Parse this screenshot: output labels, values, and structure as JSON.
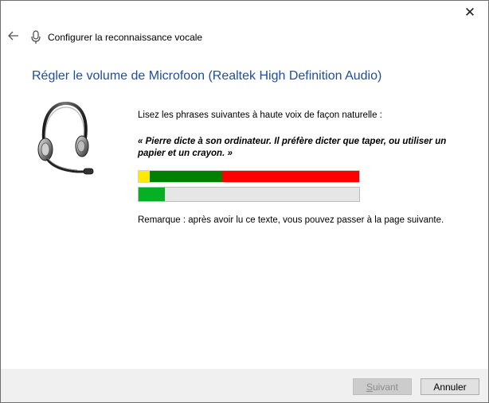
{
  "window": {
    "close_label": "✕"
  },
  "header": {
    "title": "Configurer la reconnaissance vocale"
  },
  "main": {
    "heading": "Régler le volume de Microfoon (Realtek High Definition Audio)",
    "instruction": "Lisez les phrases suivantes à haute voix de façon naturelle :",
    "sample_text": "« Pierre dicte à son ordinateur. Il préfère dicter que taper, ou utiliser un papier et un crayon. »",
    "note": "Remarque : après avoir lu ce texte, vous pouvez passer à la page suivante."
  },
  "meter": {
    "zones": [
      {
        "name": "low",
        "fraction": 0.05,
        "color": "#ffeb00"
      },
      {
        "name": "good",
        "fraction": 0.33,
        "color": "#008000"
      },
      {
        "name": "high",
        "fraction": 0.62,
        "color": "#ff0000"
      }
    ],
    "input_level": 0.12
  },
  "footer": {
    "next_label": "Suivant",
    "next_enabled": false,
    "cancel_label": "Annuler"
  }
}
